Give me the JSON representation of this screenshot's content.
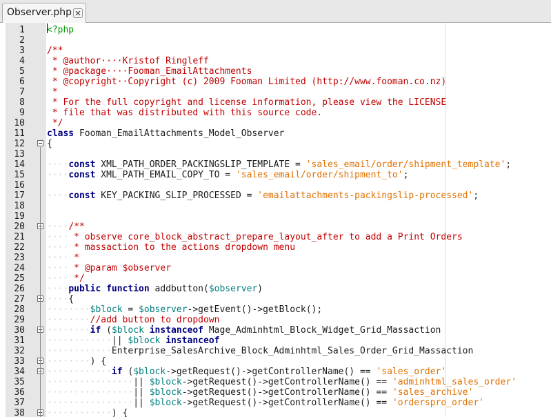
{
  "tab": {
    "title": "Observer.php",
    "close_icon": "close-icon"
  },
  "colors": {
    "keyword": "#00007f",
    "comment": "#c00000",
    "string": "#e07000",
    "variable": "#007d7d",
    "plain": "#1a1a1a",
    "tag": "#009600",
    "whitespace": "#cfcfcf"
  },
  "lines": [
    {
      "n": "1",
      "fold": "",
      "t": [
        [
          "tg",
          "<?php"
        ]
      ]
    },
    {
      "n": "2",
      "fold": "",
      "t": []
    },
    {
      "n": "3",
      "fold": "",
      "t": [
        [
          "cm",
          "/**"
        ]
      ]
    },
    {
      "n": "4",
      "fold": "",
      "t": [
        [
          "cm",
          " * @author····Kristof Ringleff"
        ]
      ]
    },
    {
      "n": "5",
      "fold": "",
      "t": [
        [
          "cm",
          " * @package····Fooman_EmailAttachments"
        ]
      ]
    },
    {
      "n": "6",
      "fold": "",
      "t": [
        [
          "cm",
          " * @copyright··Copyright (c) 2009 Fooman Limited (http://www.fooman.co.nz)"
        ]
      ]
    },
    {
      "n": "7",
      "fold": "",
      "t": [
        [
          "cm",
          " *"
        ]
      ]
    },
    {
      "n": "8",
      "fold": "",
      "t": [
        [
          "cm",
          " * For the full copyright and license information, please view the LICENSE"
        ]
      ]
    },
    {
      "n": "9",
      "fold": "",
      "t": [
        [
          "cm",
          " * file that was distributed with this source code."
        ]
      ]
    },
    {
      "n": "10",
      "fold": "",
      "t": [
        [
          "cm",
          " */"
        ]
      ]
    },
    {
      "n": "11",
      "fold": "",
      "t": [
        [
          "kw",
          "class"
        ],
        [
          "pl",
          " Fooman_EmailAttachments_Model_Observer"
        ]
      ]
    },
    {
      "n": "12",
      "fold": "open",
      "t": [
        [
          "pl",
          "{"
        ]
      ]
    },
    {
      "n": "13",
      "fold": "",
      "t": []
    },
    {
      "n": "14",
      "fold": "",
      "t": [
        [
          "ws",
          "····"
        ],
        [
          "kw",
          "const"
        ],
        [
          "pl",
          " XML_PATH_ORDER_PACKINGSLIP_TEMPLATE = "
        ],
        [
          "st",
          "'sales_email/order/shipment_template'"
        ],
        [
          "pl",
          ";"
        ]
      ]
    },
    {
      "n": "15",
      "fold": "",
      "t": [
        [
          "ws",
          "····"
        ],
        [
          "kw",
          "const"
        ],
        [
          "pl",
          " XML_PATH_EMAIL_COPY_TO = "
        ],
        [
          "st",
          "'sales_email/order/shipment_to'"
        ],
        [
          "pl",
          ";"
        ]
      ]
    },
    {
      "n": "16",
      "fold": "",
      "t": []
    },
    {
      "n": "17",
      "fold": "",
      "t": [
        [
          "ws",
          "····"
        ],
        [
          "kw",
          "const"
        ],
        [
          "pl",
          " KEY_PACKING_SLIP_PROCESSED = "
        ],
        [
          "st",
          "'emailattachments-packingslip-processed'"
        ],
        [
          "pl",
          ";"
        ]
      ]
    },
    {
      "n": "18",
      "fold": "",
      "t": []
    },
    {
      "n": "19",
      "fold": "",
      "t": []
    },
    {
      "n": "20",
      "fold": "open",
      "t": [
        [
          "ws",
          "····"
        ],
        [
          "cm",
          "/**"
        ]
      ]
    },
    {
      "n": "21",
      "fold": "",
      "t": [
        [
          "ws",
          "····"
        ],
        [
          "cm",
          " * observe core_block_abstract_prepare_layout_after to add a Print Orders"
        ]
      ]
    },
    {
      "n": "22",
      "fold": "",
      "t": [
        [
          "ws",
          "····"
        ],
        [
          "cm",
          " * massaction to the actions dropdown menu"
        ]
      ]
    },
    {
      "n": "23",
      "fold": "",
      "t": [
        [
          "ws",
          "····"
        ],
        [
          "cm",
          " *"
        ]
      ]
    },
    {
      "n": "24",
      "fold": "",
      "t": [
        [
          "ws",
          "····"
        ],
        [
          "cm",
          " * @param $observer"
        ]
      ]
    },
    {
      "n": "25",
      "fold": "",
      "t": [
        [
          "ws",
          "····"
        ],
        [
          "cm",
          " */"
        ]
      ]
    },
    {
      "n": "26",
      "fold": "",
      "t": [
        [
          "ws",
          "····"
        ],
        [
          "kw",
          "public function"
        ],
        [
          "pl",
          " addbutton("
        ],
        [
          "var",
          "$observer"
        ],
        [
          "pl",
          ")"
        ]
      ]
    },
    {
      "n": "27",
      "fold": "open",
      "t": [
        [
          "ws",
          "····"
        ],
        [
          "pl",
          "{"
        ]
      ]
    },
    {
      "n": "28",
      "fold": "",
      "t": [
        [
          "ws",
          "········"
        ],
        [
          "var",
          "$block"
        ],
        [
          "pl",
          " = "
        ],
        [
          "var",
          "$observer"
        ],
        [
          "pl",
          "->getEvent()->getBlock();"
        ]
      ]
    },
    {
      "n": "29",
      "fold": "",
      "t": [
        [
          "ws",
          "········"
        ],
        [
          "cm",
          "//add button to dropdown"
        ]
      ]
    },
    {
      "n": "30",
      "fold": "open",
      "t": [
        [
          "ws",
          "········"
        ],
        [
          "kw",
          "if"
        ],
        [
          "pl",
          " ("
        ],
        [
          "var",
          "$block"
        ],
        [
          "pl",
          " "
        ],
        [
          "kw",
          "instanceof"
        ],
        [
          "pl",
          " Mage_Adminhtml_Block_Widget_Grid_Massaction"
        ]
      ]
    },
    {
      "n": "31",
      "fold": "",
      "t": [
        [
          "ws",
          "············"
        ],
        [
          "pl",
          "|| "
        ],
        [
          "var",
          "$block"
        ],
        [
          "pl",
          " "
        ],
        [
          "kw",
          "instanceof"
        ]
      ]
    },
    {
      "n": "32",
      "fold": "",
      "t": [
        [
          "ws",
          "············"
        ],
        [
          "pl",
          "Enterprise_SalesArchive_Block_Adminhtml_Sales_Order_Grid_Massaction"
        ]
      ]
    },
    {
      "n": "33",
      "fold": "open",
      "t": [
        [
          "ws",
          "········"
        ],
        [
          "pl",
          ") {"
        ]
      ]
    },
    {
      "n": "34",
      "fold": "open",
      "t": [
        [
          "ws",
          "············"
        ],
        [
          "kw",
          "if"
        ],
        [
          "pl",
          " ("
        ],
        [
          "var",
          "$block"
        ],
        [
          "pl",
          "->getRequest()->getControllerName() == "
        ],
        [
          "st",
          "'sales_order'"
        ]
      ]
    },
    {
      "n": "35",
      "fold": "",
      "t": [
        [
          "ws",
          "················"
        ],
        [
          "pl",
          "|| "
        ],
        [
          "var",
          "$block"
        ],
        [
          "pl",
          "->getRequest()->getControllerName() == "
        ],
        [
          "st",
          "'adminhtml_sales_order'"
        ]
      ]
    },
    {
      "n": "36",
      "fold": "",
      "t": [
        [
          "ws",
          "················"
        ],
        [
          "pl",
          "|| "
        ],
        [
          "var",
          "$block"
        ],
        [
          "pl",
          "->getRequest()->getControllerName() == "
        ],
        [
          "st",
          "'sales_archive'"
        ]
      ]
    },
    {
      "n": "37",
      "fold": "",
      "t": [
        [
          "ws",
          "················"
        ],
        [
          "pl",
          "|| "
        ],
        [
          "var",
          "$block"
        ],
        [
          "pl",
          "->getRequest()->getControllerName() == "
        ],
        [
          "st",
          "'orderspro_order'"
        ]
      ]
    },
    {
      "n": "38",
      "fold": "open",
      "t": [
        [
          "ws",
          "············"
        ],
        [
          "pl",
          ") {"
        ]
      ]
    }
  ]
}
